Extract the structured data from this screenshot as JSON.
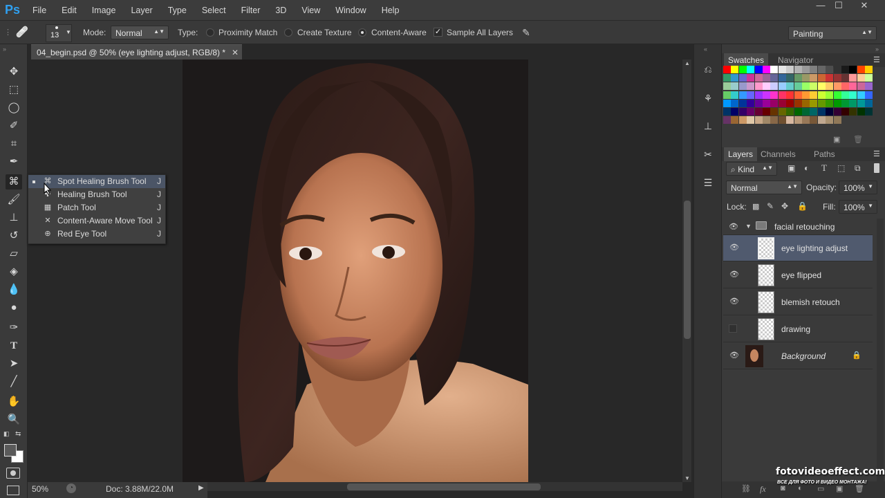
{
  "app": {
    "logo": "Ps"
  },
  "menu": [
    "File",
    "Edit",
    "Image",
    "Layer",
    "Type",
    "Select",
    "Filter",
    "3D",
    "View",
    "Window",
    "Help"
  ],
  "window_controls": {
    "minimize": "—",
    "maximize": "☐",
    "close": "✕"
  },
  "options": {
    "brush_size": "13",
    "mode_label": "Mode:",
    "mode_value": "Normal",
    "type_label": "Type:",
    "type_options": [
      "Proximity Match",
      "Create Texture",
      "Content-Aware"
    ],
    "type_selected": "Content-Aware",
    "sample_all_layers": "Sample All Layers",
    "sample_all_layers_checked": true,
    "workspace": "Painting"
  },
  "document": {
    "tab_title": "04_begin.psd @ 50% (eye lighting adjust, RGB/8) *",
    "zoom": "50%",
    "doc_size": "Doc: 3.88M/22.0M"
  },
  "flyout": {
    "items": [
      {
        "label": "Spot Healing Brush Tool",
        "key": "J",
        "selected": true
      },
      {
        "label": "Healing Brush Tool",
        "key": "J"
      },
      {
        "label": "Patch Tool",
        "key": "J"
      },
      {
        "label": "Content-Aware Move Tool",
        "key": "J"
      },
      {
        "label": "Red Eye Tool",
        "key": "J"
      }
    ]
  },
  "panels": {
    "top_tabs": [
      "Swatches",
      "Navigator"
    ],
    "layer_tabs": [
      "Layers",
      "Channels",
      "Paths"
    ],
    "kind_label": "Kind",
    "blend_mode": "Normal",
    "opacity_label": "Opacity:",
    "opacity_value": "100%",
    "lock_label": "Lock:",
    "fill_label": "Fill:",
    "fill_value": "100%"
  },
  "layers": {
    "group": "facial retouching",
    "items": [
      {
        "name": "eye lighting adjust",
        "visible": true,
        "selected": true
      },
      {
        "name": "eye flipped",
        "visible": true
      },
      {
        "name": "blemish retouch",
        "visible": true
      },
      {
        "name": "drawing",
        "visible": false
      },
      {
        "name": "Background",
        "visible": true,
        "locked": true
      }
    ]
  },
  "swatch_colors": [
    [
      "#ff0000",
      "#ffff00",
      "#00ff00",
      "#00ffff",
      "#0000ff",
      "#ff00ff",
      "#ffffff",
      "#e5e5e5",
      "#cccccc",
      "#b3b3b3",
      "#999999",
      "#808080",
      "#666666",
      "#4d4d4d",
      "#333333",
      "#1a1a1a",
      "#000000",
      "#ff4400",
      "#ffcc00"
    ],
    [
      "#339966",
      "#3399cc",
      "#6666cc",
      "#cc3399",
      "#cc6699",
      "#996699",
      "#666699",
      "#336699",
      "#336666",
      "#669966",
      "#999966",
      "#cc9966",
      "#cc6633",
      "#cc3333",
      "#993333",
      "#663333",
      "#ff9999",
      "#ffcc99",
      "#ccff99"
    ],
    [
      "#99cc99",
      "#99cccc",
      "#9999cc",
      "#cc99cc",
      "#ff99cc",
      "#ffccff",
      "#ccccff",
      "#99ccff",
      "#66cccc",
      "#66cc99",
      "#99ff66",
      "#ccff66",
      "#ffff66",
      "#ffcc66",
      "#ff9966",
      "#ff6666",
      "#ff6699",
      "#cc6699",
      "#9966cc"
    ],
    [
      "#66cc66",
      "#33cccc",
      "#3399ff",
      "#6666ff",
      "#9933ff",
      "#cc33ff",
      "#ff33cc",
      "#ff3366",
      "#ff3333",
      "#ff6633",
      "#ff9933",
      "#ffcc33",
      "#ccff33",
      "#99ff33",
      "#33ff33",
      "#33ff99",
      "#33ffcc",
      "#33ccff",
      "#3366ff"
    ],
    [
      "#0099ff",
      "#0066cc",
      "#003399",
      "#330099",
      "#660099",
      "#990099",
      "#990066",
      "#990033",
      "#990000",
      "#993300",
      "#996600",
      "#999900",
      "#669900",
      "#339900",
      "#009900",
      "#009933",
      "#009966",
      "#009999",
      "#006699"
    ],
    [
      "#003366",
      "#000066",
      "#330066",
      "#660066",
      "#660033",
      "#660000",
      "#663300",
      "#666600",
      "#336600",
      "#006600",
      "#006633",
      "#006666",
      "#003366",
      "#000033",
      "#330033",
      "#330000",
      "#333300",
      "#003300",
      "#003333"
    ],
    [
      "#663366",
      "#996633",
      "#cc9966",
      "#e0c8a8",
      "#c8a888",
      "#a08868",
      "#886848",
      "#705030",
      "#d8b8a0",
      "#b89878",
      "#987858",
      "#785838",
      "#c0a890",
      "#a89070",
      "#907858"
    ]
  ]
}
